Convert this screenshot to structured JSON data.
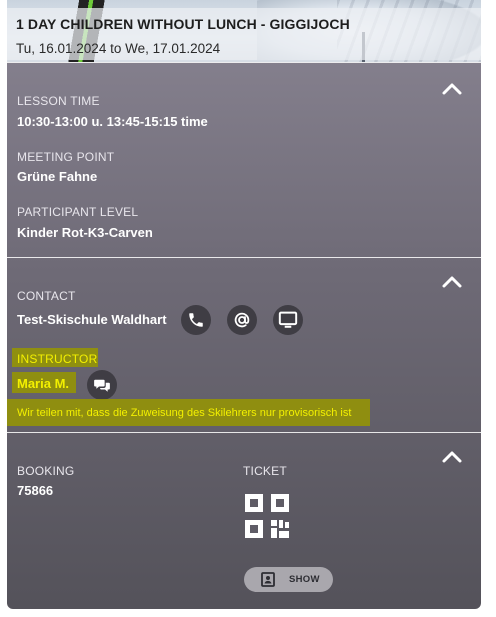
{
  "course": {
    "title": "1 DAY CHILDREN WITHOUT LUNCH - GIGGIJOCH",
    "dates": "Tu, 16.01.2024 to We, 17.01.2024"
  },
  "details": {
    "lesson_time_label": "LESSON TIME",
    "lesson_time_value": "10:30-13:00 u. 13:45-15:15 time",
    "meeting_point_label": "MEETING POINT",
    "meeting_point_value": "Grüne Fahne",
    "participant_level_label": "PARTICIPANT LEVEL",
    "participant_level_value": "Kinder Rot-K3-Carven"
  },
  "contact": {
    "label": "CONTACT",
    "school_name": "Test-Skischule Waldhart",
    "icons": [
      "phone-icon",
      "email-icon",
      "website-icon"
    ]
  },
  "instructor": {
    "label": "INSTRUCTOR",
    "name": "Maria M.",
    "chat_icon": "chat-icon",
    "note": "Wir teilen mit, dass die Zuweisung des Skilehrers nur provisorisch ist",
    "highlight_color": "#f3f000"
  },
  "booking": {
    "booking_label": "BOOKING",
    "booking_number": "75866",
    "ticket_label": "TICKET",
    "ticket_icon": "qr-code-icon",
    "show_button_label": "SHOW",
    "show_button_icon": "ticket-card-icon"
  },
  "colors": {
    "card_top": "#8a8593",
    "card_bottom": "#54525a",
    "icon_button": "#3f3d44"
  }
}
